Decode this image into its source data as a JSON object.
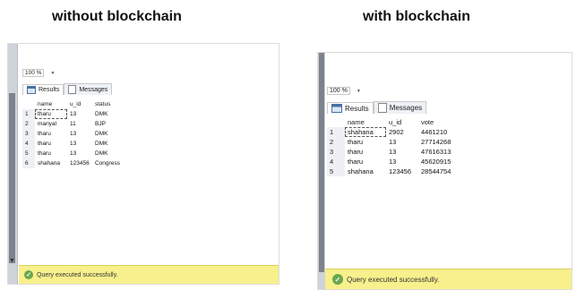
{
  "captions": {
    "left": "without blockchain",
    "right": "with blockchain"
  },
  "left_window": {
    "zoom": "100 %",
    "tabs": {
      "results": "Results",
      "messages": "Messages"
    },
    "columns": [
      "name",
      "u_id",
      "status"
    ],
    "rows": [
      {
        "n": "1",
        "name": "tharu",
        "u_id": "13",
        "value": "DMK"
      },
      {
        "n": "2",
        "name": "mariyal",
        "u_id": "11",
        "value": "BJP"
      },
      {
        "n": "3",
        "name": "tharu",
        "u_id": "13",
        "value": "DMK"
      },
      {
        "n": "4",
        "name": "tharu",
        "u_id": "13",
        "value": "DMK"
      },
      {
        "n": "5",
        "name": "tharu",
        "u_id": "13",
        "value": "DMK"
      },
      {
        "n": "6",
        "name": "shahana",
        "u_id": "123456",
        "value": "Congress"
      }
    ],
    "status_message": "Query executed successfully."
  },
  "right_window": {
    "zoom": "100 %",
    "tabs": {
      "results": "Results",
      "messages": "Messages"
    },
    "columns": [
      "name",
      "u_id",
      "vote"
    ],
    "rows": [
      {
        "n": "1",
        "name": "shahana",
        "u_id": "2902",
        "value": "4461210"
      },
      {
        "n": "2",
        "name": "tharu",
        "u_id": "13",
        "value": "27714268"
      },
      {
        "n": "3",
        "name": "tharu",
        "u_id": "13",
        "value": "47616313"
      },
      {
        "n": "4",
        "name": "tharu",
        "u_id": "13",
        "value": "45620915"
      },
      {
        "n": "5",
        "name": "shahana",
        "u_id": "123456",
        "value": "28544754"
      }
    ],
    "status_message": "Query executed successfully."
  },
  "icons": {
    "results_tab": "grid-icon",
    "messages_tab": "messages-icon",
    "status": "check-circle-icon",
    "zoom_dropdown": "chevron-down-icon"
  },
  "colors": {
    "status_bar": "#f8f08c",
    "success": "#6aa84f",
    "row_header": "#eef0f3"
  }
}
